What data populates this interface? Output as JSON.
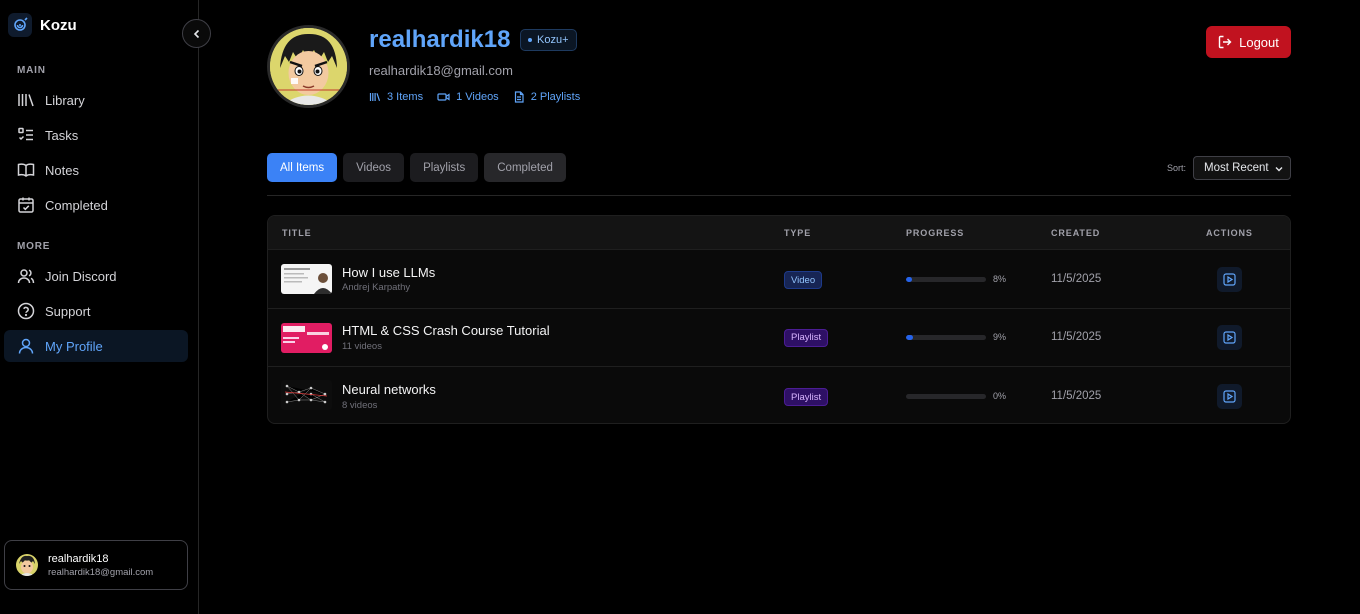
{
  "app": {
    "name": "Kozu"
  },
  "sidebar": {
    "main_label": "MAIN",
    "main_items": [
      {
        "label": "Library",
        "icon": "library-icon"
      },
      {
        "label": "Tasks",
        "icon": "tasks-icon"
      },
      {
        "label": "Notes",
        "icon": "book-icon"
      },
      {
        "label": "Completed",
        "icon": "calendar-check-icon"
      }
    ],
    "more_label": "MORE",
    "more_items": [
      {
        "label": "Join Discord",
        "icon": "users-icon"
      },
      {
        "label": "Support",
        "icon": "help-circle-icon"
      },
      {
        "label": "My Profile",
        "icon": "user-icon",
        "active": true
      }
    ],
    "user": {
      "name": "realhardik18",
      "email": "realhardik18@gmail.com"
    }
  },
  "profile": {
    "username": "realhardik18",
    "plan": "Kozu+",
    "email": "realhardik18@gmail.com",
    "stats": {
      "items": "3 Items",
      "videos": "1 Videos",
      "playlists": "2 Playlists"
    },
    "logout_label": "Logout"
  },
  "filters": {
    "tabs": [
      "All Items",
      "Videos",
      "Playlists",
      "Completed"
    ],
    "active_tab": "All Items",
    "sort_label": "Sort:",
    "sort_value": "Most Recent"
  },
  "table": {
    "headers": {
      "title": "TITLE",
      "type": "TYPE",
      "progress": "PROGRESS",
      "created": "CREATED",
      "actions": "ACTIONS"
    },
    "rows": [
      {
        "title": "How I use LLMs",
        "subtitle": "Andrej Karpathy",
        "type": "Video",
        "progress": 8,
        "progress_label": "8%",
        "created": "11/5/2025"
      },
      {
        "title": "HTML & CSS Crash Course Tutorial",
        "subtitle": "11 videos",
        "type": "Playlist",
        "progress": 9,
        "progress_label": "9%",
        "created": "11/5/2025"
      },
      {
        "title": "Neural networks",
        "subtitle": "8 videos",
        "type": "Playlist",
        "progress": 0,
        "progress_label": "0%",
        "created": "11/5/2025"
      }
    ]
  },
  "colors": {
    "accent": "#3b82f6",
    "logout": "#c1121f",
    "video_badge": "#93c5fd",
    "playlist_badge": "#d8b4fe"
  }
}
